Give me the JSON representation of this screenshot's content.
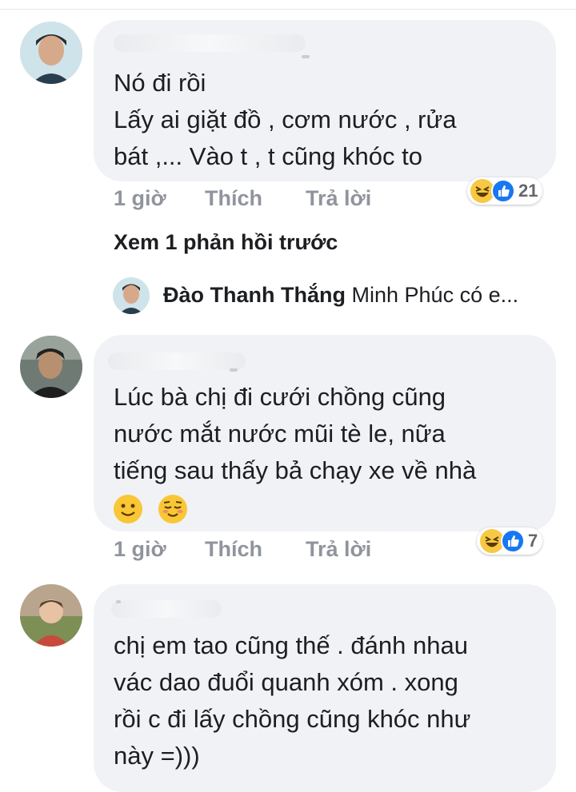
{
  "comments": [
    {
      "lines": [
        "Nó đi rồi",
        "Lấy ai giặt đồ , cơm nước , rửa",
        "bát ,... Vào t , t cũng khóc to"
      ],
      "time": "1 giờ",
      "like_label": "Thích",
      "reply_label": "Trả lời",
      "reaction_count": "21",
      "reactions": [
        "haha-icon",
        "like-icon"
      ]
    },
    {
      "lines": [
        "Lúc bà chị đi cưới chồng cũng",
        "nước mắt nước mũi tè le, nữa",
        "tiếng sau thấy bả chạy xe về nhà"
      ],
      "emoji": [
        "slightly-smiling-face-icon",
        "relieved-face-icon"
      ],
      "time": "1 giờ",
      "like_label": "Thích",
      "reply_label": "Trả lời",
      "reaction_count": "7",
      "reactions": [
        "haha-icon",
        "like-icon"
      ]
    },
    {
      "lines": [
        "chị em tao cũng thế . đánh nhau",
        "vác dao đuổi quanh xóm . xong",
        "rồi c đi lấy chồng cũng khóc như",
        "này =)))"
      ]
    }
  ],
  "view_replies": "Xem 1 phản hồi trước",
  "reply_preview": {
    "name": "Đào Thanh Thắng",
    "text": "Minh Phúc có e..."
  },
  "colors": {
    "bubble": "#f0f2f5",
    "meta": "#90949c",
    "like_blue": "#1877f2",
    "haha_yellow": "#f7c843"
  }
}
